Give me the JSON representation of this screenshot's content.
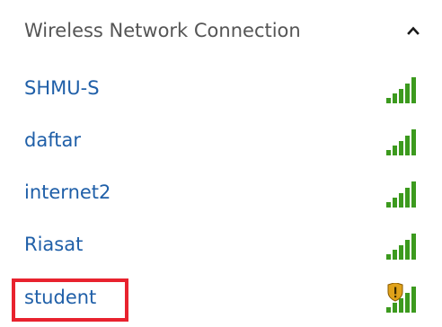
{
  "section": {
    "title": "Wireless Network Connection",
    "collapse_icon": "chevron-up-icon"
  },
  "networks": [
    {
      "name": "SHMU-S",
      "signal_icon": "signal-full-icon",
      "secured_warning": false
    },
    {
      "name": "daftar",
      "signal_icon": "signal-full-icon",
      "secured_warning": false
    },
    {
      "name": "internet2",
      "signal_icon": "signal-full-icon",
      "secured_warning": false
    },
    {
      "name": "Riasat",
      "signal_icon": "signal-full-icon",
      "secured_warning": false
    },
    {
      "name": "student",
      "signal_icon": "signal-full-shield-icon",
      "secured_warning": true
    }
  ],
  "colors": {
    "link": "#1f5fa8",
    "header_text": "#555555",
    "signal_green": "#3c9a1e",
    "highlight_red": "#e8222e",
    "shield_gold": "#e0a21a"
  }
}
